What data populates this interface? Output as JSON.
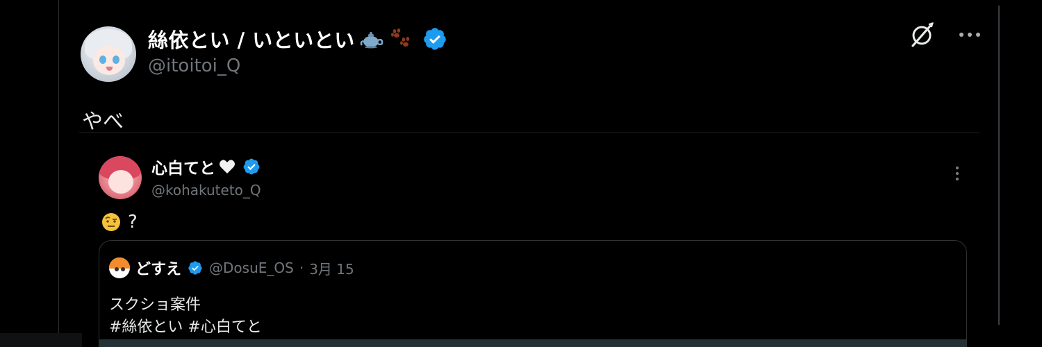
{
  "post": {
    "author": {
      "display_name": "絲依とい / いといとい",
      "handle": "@itoitoi_Q",
      "name_emojis": [
        "teapot-emoji",
        "paw-prints-emoji"
      ],
      "verified": true
    },
    "text": "やべ",
    "actions": {
      "grok_icon": "grok-icon",
      "more_icon": "more-horizontal-icon"
    }
  },
  "quoted_post": {
    "author": {
      "display_name": "心白てと",
      "name_emoji": "white-heart-emoji",
      "handle": "@kohakuteto_Q",
      "verified": true
    },
    "text_emoji": "face-with-raised-eyebrow-emoji",
    "text": "?",
    "more_icon": "more-vertical-icon"
  },
  "nested_quote": {
    "author": {
      "display_name": "どすえ",
      "handle": "@DosuE_OS",
      "verified": true
    },
    "separator": "·",
    "date": "3月 15",
    "lines": [
      "スクショ案件",
      "#絲依とい #心白てと"
    ]
  },
  "colors": {
    "background": "#000000",
    "text_primary": "#e7e9ea",
    "text_secondary": "#71767b",
    "verified_blue": "#1d9bf0",
    "card_border": "#2f3336"
  }
}
